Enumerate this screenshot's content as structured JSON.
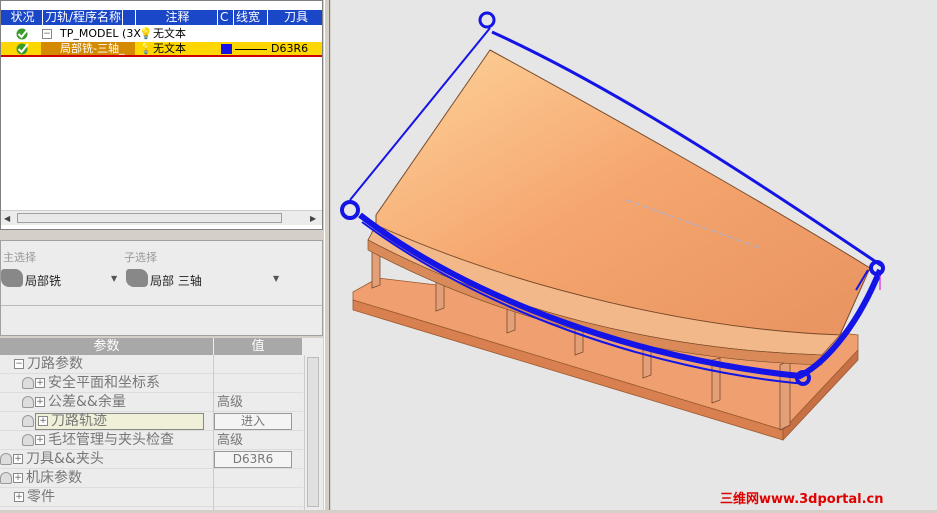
{
  "toolpath_tree": {
    "columns": [
      "状况",
      "刀轨/程序名称",
      "",
      "注释",
      "C",
      "线宽",
      "刀具"
    ],
    "rows": [
      {
        "name": "TP_MODEL (3X",
        "comment": "无文本",
        "tool": ""
      },
      {
        "name": "局部铣-三轴_",
        "comment": "无文本",
        "tool": "D63R6"
      }
    ]
  },
  "selection": {
    "main_label": "主选择",
    "main_value": "局部铣",
    "sub_label": "子选择",
    "sub_value": "局部 三轴"
  },
  "params": {
    "col_param": "参数",
    "col_value": "值",
    "rows": [
      {
        "name": "刀路参数",
        "value": ""
      },
      {
        "name": "安全平面和坐标系",
        "value": ""
      },
      {
        "name": "公差&&余量",
        "value": "高级"
      },
      {
        "name": "刀路轨迹",
        "value": "进入"
      },
      {
        "name": "毛坯管理与夹头检查",
        "value": "高级"
      },
      {
        "name": "刀具&&夹头",
        "value": "D63R6"
      },
      {
        "name": "机床参数",
        "value": ""
      },
      {
        "name": "零件",
        "value": ""
      }
    ]
  },
  "watermark": "三维网www.3dportal.cn",
  "colors": {
    "header": "#1a46c8",
    "selected_row": "#ffd700",
    "toolpath": "#1414e6",
    "part": "#f0a070"
  }
}
